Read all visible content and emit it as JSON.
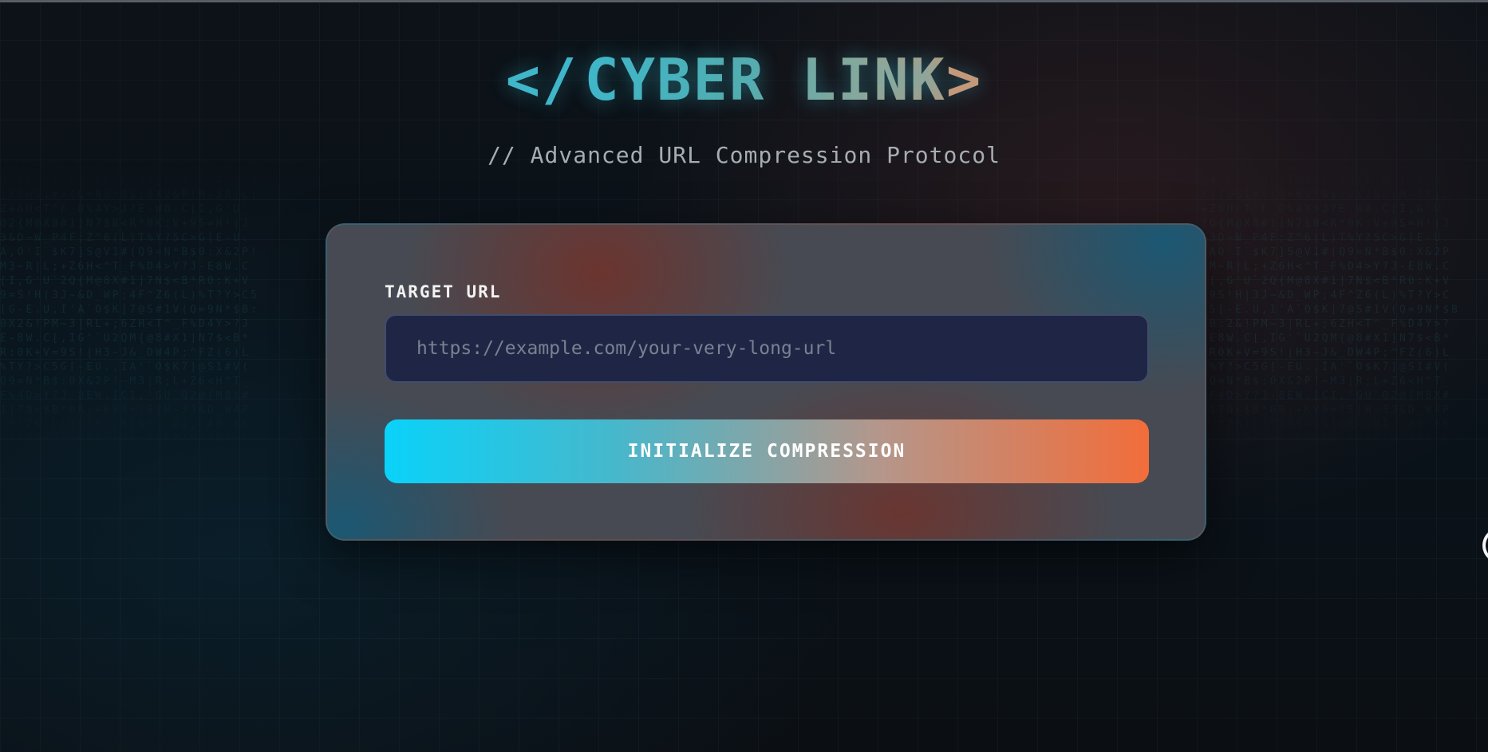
{
  "header": {
    "logo_open": "</",
    "logo_text": "CYBER LINK",
    "logo_close": ">",
    "subtitle": "// Advanced URL Compression Protocol"
  },
  "form": {
    "label": "TARGET URL",
    "url_value": "",
    "url_placeholder": "https://example.com/your-very-long-url",
    "button_label": "INITIALIZE COMPRESSION"
  },
  "colors": {
    "accent_cyan": "#0ad2f9",
    "accent_orange": "#f26d3a",
    "background": "#0b1117",
    "input_background": "#1f2645"
  },
  "icons": {
    "edge_fragment": "partial-circle-icon"
  }
}
